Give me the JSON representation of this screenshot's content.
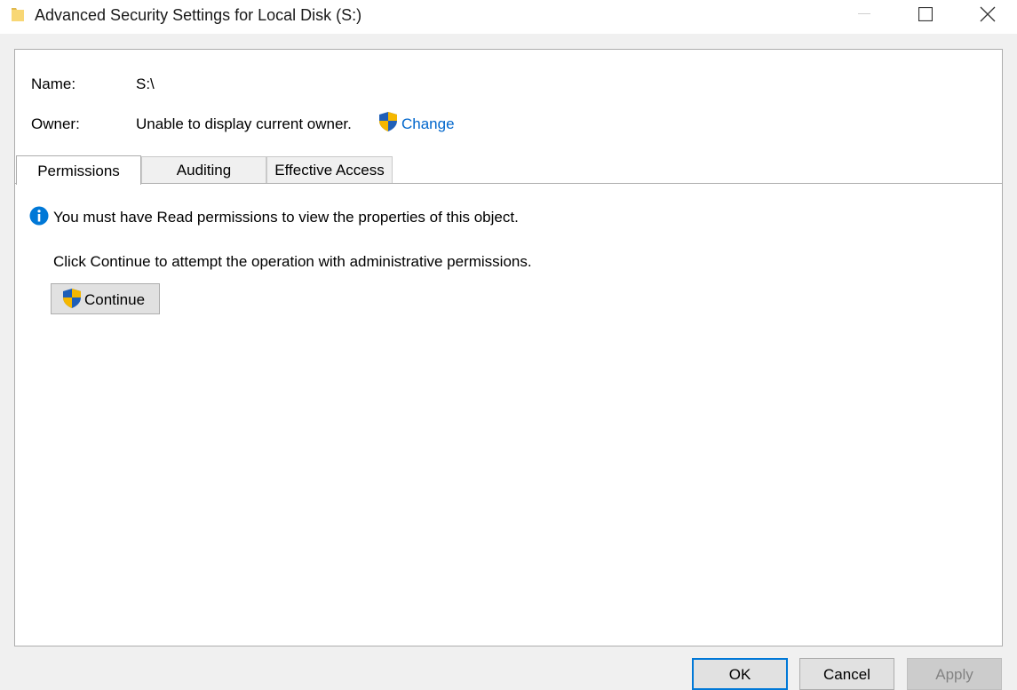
{
  "window": {
    "title": "Advanced Security Settings for Local Disk (S:)",
    "icon": "folder-icon"
  },
  "object": {
    "name_label": "Name:",
    "name_value": "S:\\",
    "owner_label": "Owner:",
    "owner_value": "Unable to display current owner.",
    "change_link": "Change"
  },
  "tabs": [
    {
      "label": "Permissions",
      "active": true
    },
    {
      "label": "Auditing",
      "active": false
    },
    {
      "label": "Effective Access",
      "active": false
    }
  ],
  "message": {
    "info": "You must have Read permissions to view the properties of this object.",
    "hint": "Click Continue to attempt the operation with administrative permissions.",
    "continue_label": "Continue"
  },
  "buttons": {
    "ok": "OK",
    "cancel": "Cancel",
    "apply": "Apply"
  },
  "colors": {
    "link": "#0066cc",
    "focus_border": "#0078d7",
    "info_icon": "#0078d7",
    "shield_blue": "#1f5fb8",
    "shield_yellow": "#f5b700"
  }
}
